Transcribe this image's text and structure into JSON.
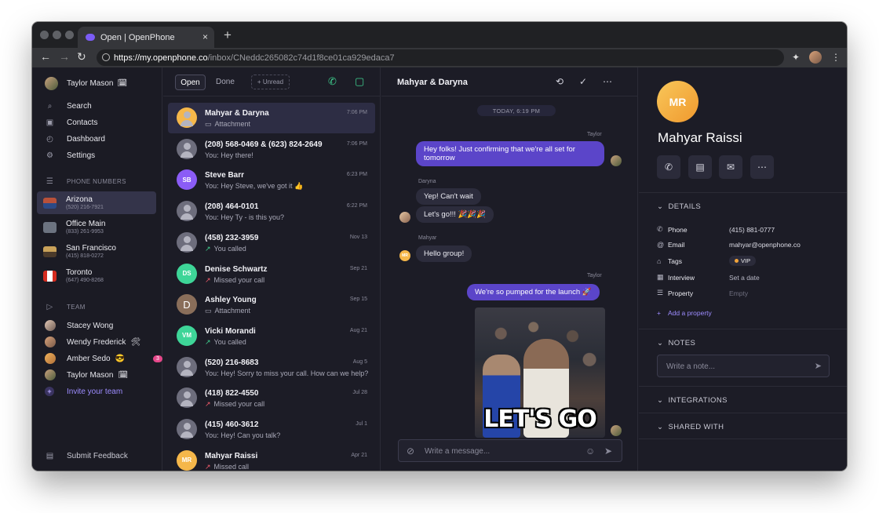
{
  "browser": {
    "tab_title": "Open | OpenPhone",
    "tab_close": "×",
    "new_tab": "+",
    "url_host": "https://my.openphone.co",
    "url_path": "/inbox/CNeddc265082c74d1f8ce01ca929edaca7"
  },
  "sidebar": {
    "user": {
      "name": "Taylor Mason",
      "emoji": "🗓"
    },
    "nav": [
      {
        "label": "Search",
        "icon": "search-icon"
      },
      {
        "label": "Contacts",
        "icon": "contacts-icon"
      },
      {
        "label": "Dashboard",
        "icon": "dashboard-icon"
      },
      {
        "label": "Settings",
        "icon": "gear-icon"
      }
    ],
    "phone_numbers_header": "PHONE NUMBERS",
    "phone_numbers": [
      {
        "name": "Arizona",
        "number": "(520) 216-7921",
        "selected": true
      },
      {
        "name": "Office Main",
        "number": "(833) 261-9953",
        "selected": false
      },
      {
        "name": "San Francisco",
        "number": "(415) 818-0272",
        "selected": false
      },
      {
        "name": "Toronto",
        "number": "(647) 490-8268",
        "selected": false
      }
    ],
    "team_header": "TEAM",
    "team": [
      {
        "name": "Stacey Wong",
        "emoji": ""
      },
      {
        "name": "Wendy Frederick",
        "emoji": "🛠"
      },
      {
        "name": "Amber Sedo",
        "emoji": "😎",
        "badge": "3"
      },
      {
        "name": "Taylor Mason",
        "emoji": "🗓"
      }
    ],
    "invite": "Invite your team",
    "feedback": "Submit Feedback"
  },
  "inbox": {
    "filters": {
      "open": "Open",
      "done": "Done",
      "unread": "+ Unread"
    },
    "conversations": [
      {
        "name": "Mahyar & Daryna",
        "preview": "Attachment",
        "time": "7:06 PM",
        "selected": true,
        "avatar": "",
        "color": "#f5b74a",
        "kind": "attach"
      },
      {
        "name": "(208) 568-0469 & (623) 824-2649",
        "preview": "You: Hey there!",
        "time": "7:06 PM",
        "avatar": "",
        "color": "#6d6d7c",
        "kind": "text"
      },
      {
        "name": "Steve Barr",
        "preview": "You: Hey Steve, we've got it 👍",
        "time": "6:23 PM",
        "avatar": "SB",
        "color": "#8b5cf6",
        "kind": "text"
      },
      {
        "name": "(208) 464-0101",
        "preview": "You: Hey Ty - is this you?",
        "time": "6:22 PM",
        "avatar": "",
        "color": "#6d6d7c",
        "kind": "text"
      },
      {
        "name": "(458) 232-3959",
        "preview": "You called",
        "time": "Nov 13",
        "avatar": "",
        "color": "#6d6d7c",
        "kind": "out"
      },
      {
        "name": "Denise Schwartz",
        "preview": "Missed your call",
        "time": "Sep 21",
        "avatar": "DS",
        "color": "#3ed598",
        "kind": "missed"
      },
      {
        "name": "Ashley Young",
        "preview": "Attachment",
        "time": "Sep 15",
        "avatar": "D",
        "color": "#8a6e5a",
        "kind": "attach"
      },
      {
        "name": "Vicki Morandi",
        "preview": "You called",
        "time": "Aug 21",
        "avatar": "VM",
        "color": "#3ed598",
        "kind": "out"
      },
      {
        "name": "(520) 216-8683",
        "preview": "You: Hey! Sorry to miss your call. How can we help?",
        "time": "Aug 5",
        "avatar": "",
        "color": "#6d6d7c",
        "kind": "text"
      },
      {
        "name": "(418) 822-4550",
        "preview": "Missed your call",
        "time": "Jul 28",
        "avatar": "",
        "color": "#6d6d7c",
        "kind": "missed"
      },
      {
        "name": "(415) 460-3612",
        "preview": "You: Hey! Can you talk?",
        "time": "Jul 1",
        "avatar": "",
        "color": "#6d6d7c",
        "kind": "text"
      },
      {
        "name": "Mahyar Raissi",
        "preview": "Missed call",
        "time": "Apr 21",
        "avatar": "MR",
        "color": "#f5b74a",
        "kind": "missed"
      }
    ]
  },
  "chat": {
    "title": "Mahyar & Daryna",
    "day": "TODAY, 6:19 PM",
    "messages": {
      "m1_sender": "Taylor",
      "m1": "Hey folks! Just confirming that we're all set for tomorrow",
      "m2_sender": "Daryna",
      "m2": "Yep! Can't wait",
      "m3": "Let's go!!! 🎉🎉🎉",
      "m4_sender": "Mahyar",
      "m4": "Hello group!",
      "m5_sender": "Taylor",
      "m5": "We're so pumped for the launch 🚀",
      "gif_text": "LET'S GO"
    },
    "compose_placeholder": "Write a message..."
  },
  "contact": {
    "initials": "MR",
    "name": "Mahyar Raissi",
    "details_header": "DETAILS",
    "details": [
      {
        "key": "Phone",
        "value": "(415) 881-0777",
        "icon": "phone-icon"
      },
      {
        "key": "Email",
        "value": "mahyar@openphone.co",
        "icon": "at-icon"
      },
      {
        "key": "Tags",
        "value": "VIP",
        "icon": "tag-icon"
      },
      {
        "key": "Interview",
        "value": "Set a date",
        "icon": "calendar-icon"
      },
      {
        "key": "Property",
        "value": "Empty",
        "icon": "list-icon"
      }
    ],
    "add_property": "Add a property",
    "notes_header": "NOTES",
    "note_placeholder": "Write a note...",
    "integrations_header": "INTEGRATIONS",
    "shared_header": "SHARED WITH"
  }
}
